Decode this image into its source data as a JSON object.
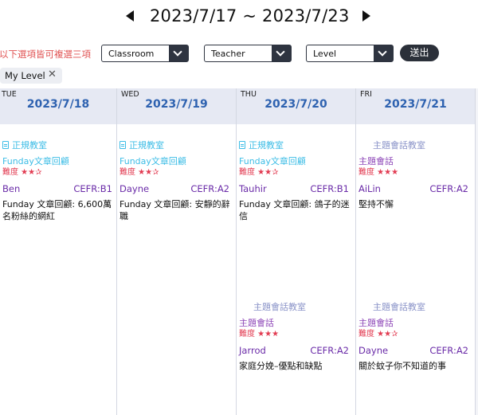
{
  "week": {
    "range": "2023/7/17 ~ 2023/7/23",
    "prev_icon": "triangle-left-icon",
    "next_icon": "triangle-right-icon"
  },
  "filters": {
    "hint": "以下選項皆可複選三項",
    "classroom": "Classroom",
    "teacher": "Teacher",
    "level": "Level",
    "submit": "送出"
  },
  "chip": {
    "label": "My Level",
    "remove": "✕"
  },
  "days": [
    {
      "abbr": "TUE",
      "date": "2023/7/18"
    },
    {
      "abbr": "WED",
      "date": "2023/7/19"
    },
    {
      "abbr": "THU",
      "date": "2023/7/20"
    },
    {
      "abbr": "FRI",
      "date": "2023/7/21"
    }
  ],
  "classes": {
    "tue_1": {
      "room": "正規教室",
      "course": "Funday文章回顧",
      "difficulty": "難度 ★★✰",
      "teacher": "Ben",
      "cefr": "CEFR:B1",
      "title": "Funday 文章回顧: 6,600萬名粉絲的網紅"
    },
    "wed_1": {
      "room": "正規教室",
      "course": "Funday文章回顧",
      "difficulty": "難度 ★★✰",
      "teacher": "Dayne",
      "cefr": "CEFR:A2",
      "title": "Funday 文章回顧: 安靜的辭職"
    },
    "thu_1": {
      "room": "正規教室",
      "course": "Funday文章回顧",
      "difficulty": "難度 ★★✰",
      "teacher": "Tauhir",
      "cefr": "CEFR:B1",
      "title": "Funday 文章回顧: 鴿子的迷信"
    },
    "fri_1": {
      "room": "主題會話教室",
      "course": "主題會話",
      "difficulty": "難度 ★★★",
      "teacher": "AiLin",
      "cefr": "CEFR:A2",
      "title": "堅持不懈"
    },
    "thu_2": {
      "room": "主題會話教室",
      "course": "主題會話",
      "difficulty": "難度 ★★★",
      "teacher": "Jarrod",
      "cefr": "CEFR:A2",
      "title": "家庭分娩–優點和缺點"
    },
    "fri_2": {
      "room": "主題會話教室",
      "course": "主題會話",
      "difficulty": "難度 ★★✰",
      "teacher": "Dayne",
      "cefr": "CEFR:A2",
      "title": "關於蚊子你不知道的事"
    }
  }
}
